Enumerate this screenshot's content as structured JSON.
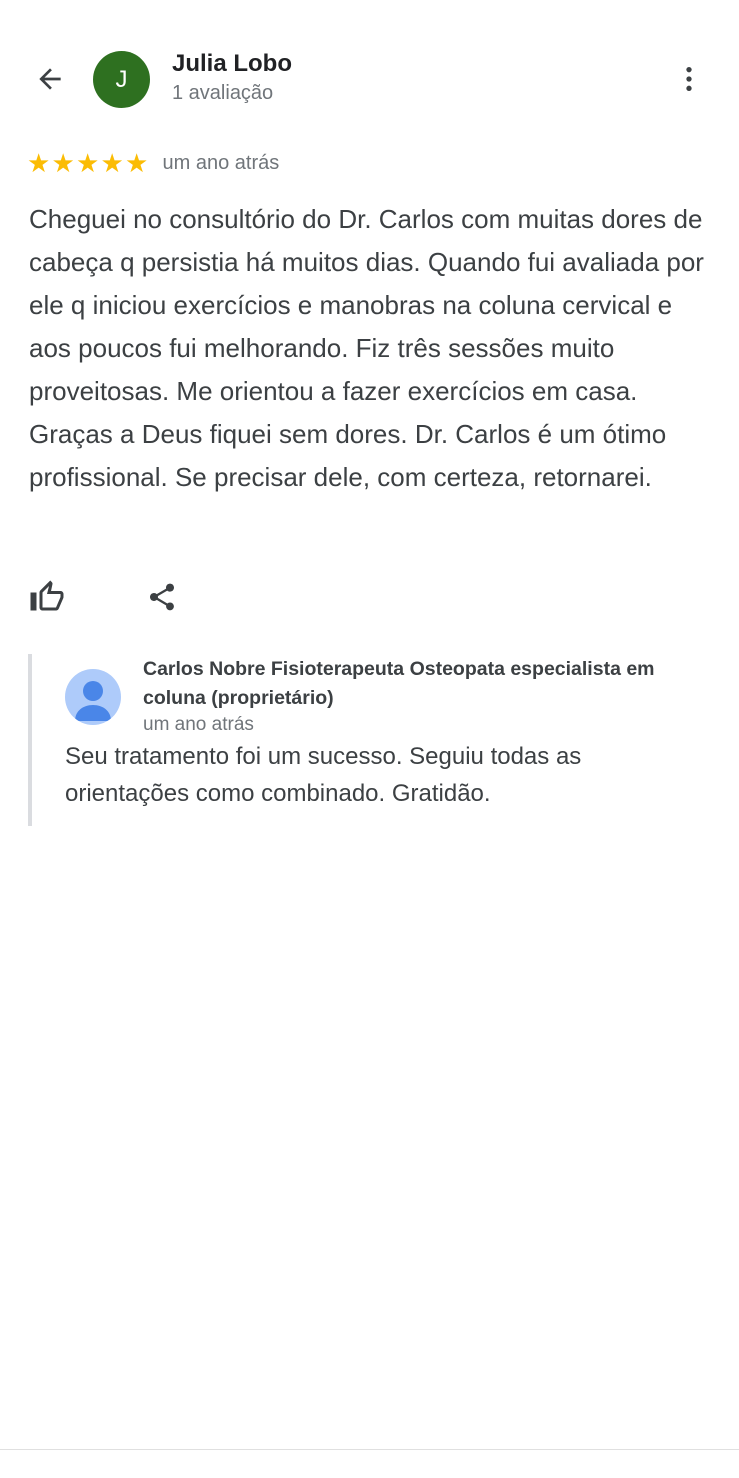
{
  "header": {
    "avatar_letter": "J",
    "avatar_color": "#2e7020",
    "reviewer_name": "Julia Lobo",
    "reviewer_meta": "1 avaliação",
    "back_icon": "arrow-left-icon",
    "more_icon": "more-vert-icon"
  },
  "review": {
    "rating": 5,
    "rating_max": 5,
    "star_color": "#fbbc04",
    "date": "um ano atrás",
    "text": "Cheguei no consultório do Dr. Carlos com muitas dores de cabeça q persistia há muitos dias. Quando fui avaliada por ele q iniciou exercícios e manobras na coluna cervical e aos poucos fui melhorando. Fiz três sessões muito proveitosas. Me orientou a fazer exercícios em casa. Graças a Deus fiquei sem dores. Dr. Carlos é um ótimo profissional. Se precisar dele, com certeza, retornarei."
  },
  "actions": {
    "like_icon": "thumb-up-icon",
    "share_icon": "share-icon"
  },
  "reply": {
    "owner_name": "Carlos Nobre Fisioterapeuta Osteopata especialista em coluna (proprietário)",
    "date": "um ano atrás",
    "text": "Seu tratamento foi um sucesso. Seguiu todas as orientações como combinado. Gratidão.",
    "avatar_icon": "person-icon"
  }
}
